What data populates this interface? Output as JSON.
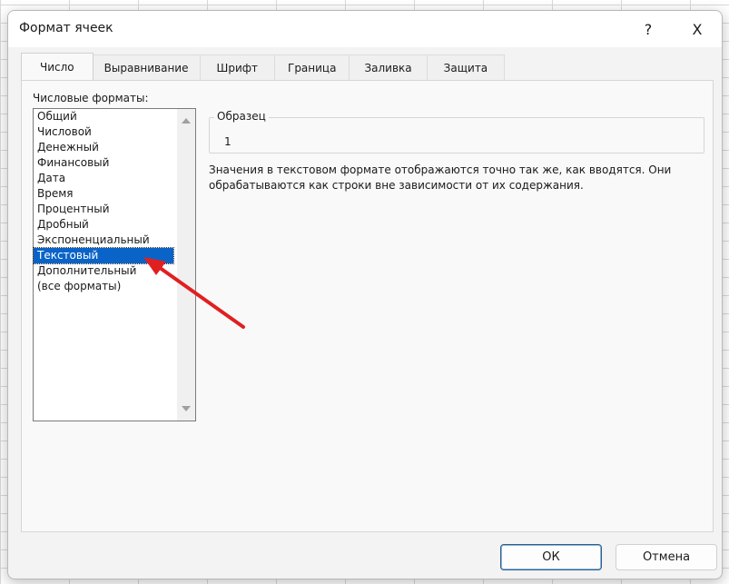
{
  "dialog": {
    "title": "Формат ячеек",
    "help_label": "?",
    "close_label": "X"
  },
  "tabs": [
    "Число",
    "Выравнивание",
    "Шрифт",
    "Граница",
    "Заливка",
    "Защита"
  ],
  "number": {
    "formats_label": "Числовые форматы:",
    "formats": [
      "Общий",
      "Числовой",
      "Денежный",
      "Финансовый",
      "Дата",
      "Время",
      "Процентный",
      "Дробный",
      "Экспоненциальный",
      "Текстовый",
      "Дополнительный",
      "(все форматы)"
    ],
    "selected_format": "Текстовый",
    "sample_label": "Образец",
    "sample_value": "1",
    "description": "Значения в текстовом формате отображаются точно так же, как вводятся. Они обрабатываются как строки вне зависимости от их содержания."
  },
  "buttons": {
    "ok": "ОК",
    "cancel": "Отмена"
  },
  "colors": {
    "selection": "#0a64c8",
    "arrow": "#e02020"
  }
}
